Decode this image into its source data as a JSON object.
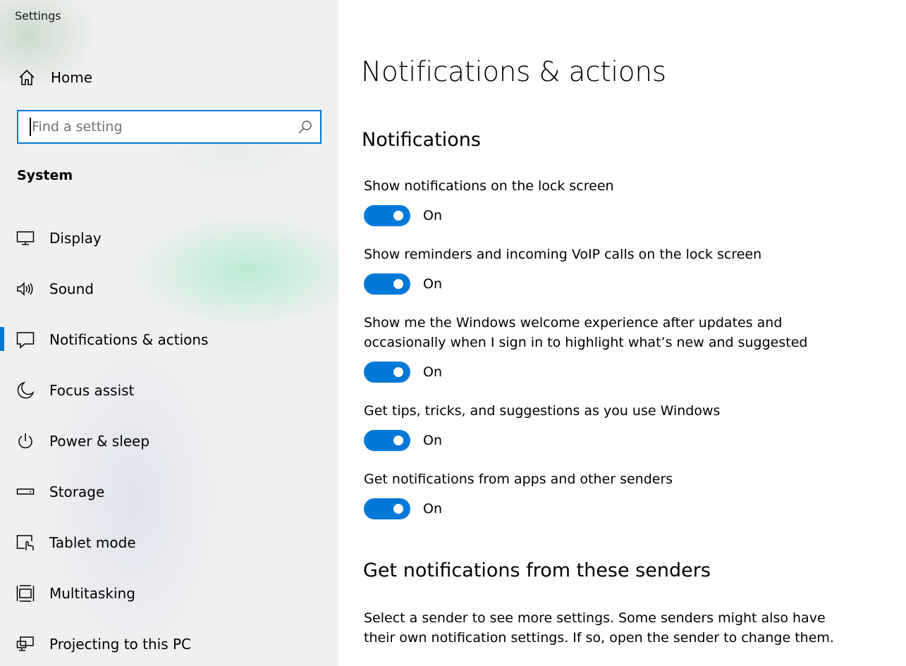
{
  "window": {
    "title": "Settings"
  },
  "sidebar": {
    "home_label": "Home",
    "search": {
      "placeholder": "Find a setting",
      "value": ""
    },
    "section_label": "System",
    "items": [
      {
        "label": "Display",
        "icon": "display-icon"
      },
      {
        "label": "Sound",
        "icon": "speaker-icon"
      },
      {
        "label": "Notifications & actions",
        "icon": "notification-icon",
        "active": true
      },
      {
        "label": "Focus assist",
        "icon": "moon-icon"
      },
      {
        "label": "Power & sleep",
        "icon": "power-icon"
      },
      {
        "label": "Storage",
        "icon": "storage-icon"
      },
      {
        "label": "Tablet mode",
        "icon": "tablet-mode-icon"
      },
      {
        "label": "Multitasking",
        "icon": "multitasking-icon"
      },
      {
        "label": "Projecting to this PC",
        "icon": "projecting-icon"
      }
    ]
  },
  "main": {
    "title": "Notifications & actions",
    "notifications_heading": "Notifications",
    "settings": [
      {
        "label": "Show notifications on the lock screen",
        "state": "On"
      },
      {
        "label": "Show reminders and incoming VoIP calls on the lock screen",
        "state": "On"
      },
      {
        "label": "Show me the Windows welcome experience after updates and occasionally when I sign in to highlight what’s new and suggested",
        "state": "On"
      },
      {
        "label": "Get tips, tricks, and suggestions as you use Windows",
        "state": "On"
      },
      {
        "label": "Get notifications from apps and other senders",
        "state": "On"
      }
    ],
    "senders_heading": "Get notifications from these senders",
    "senders_info": "Select a sender to see more settings. Some senders might also have their own notification settings. If so, open the sender to change them."
  },
  "colors": {
    "accent": "#0078d7",
    "sidebar_bg": "#f0f0f0",
    "main_bg": "#ffffff"
  }
}
